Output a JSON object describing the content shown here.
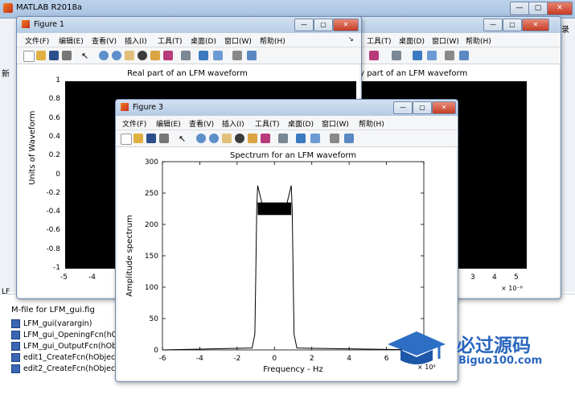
{
  "app": {
    "title": "MATLAB R2018a",
    "right_edge_text": "录",
    "left_edge_text": "新",
    "left_edge_text2": "LF",
    "m_file_label": "M-file for LFM_gui.fig",
    "functions": [
      "LFM_gui(varargin)",
      "LFM_gui_OpeningFcn(hO...",
      "LFM_gui_OutputFcn(hObj...",
      "edit1_CreateFcn(hObject,...",
      "edit2_CreateFcn(hObject,..."
    ]
  },
  "menus": [
    "文件(F)",
    "编辑(E)",
    "查看(V)",
    "插入(I)",
    "工具(T)",
    "桌面(D)",
    "窗口(W)",
    "帮助(H)"
  ],
  "figures": {
    "fig1": {
      "title": "Figure 1",
      "plot_title": "Real part of an LFM waveform",
      "ylabel": "Units of Waveform",
      "yticks": [
        "1",
        "0.8",
        "0.6",
        "0.4",
        "0.2",
        "0",
        "-0.2",
        "-0.4",
        "-0.6",
        "-0.8",
        "-1"
      ],
      "xticks": [
        "-5",
        "-4"
      ]
    },
    "fig2": {
      "plot_title_partial": "ry part of an LFM waveform",
      "xticks": [
        "3",
        "4",
        "5"
      ],
      "exponent": "× 10⁻⁶"
    },
    "fig3": {
      "title": "Figure 3",
      "plot_title": "Spectrum for an LFM waveform",
      "ylabel": "Amplitude spectrum",
      "xlabel": "Frequency - Hz",
      "exponent": "× 10⁸"
    }
  },
  "watermark": {
    "cn": "必过源码",
    "url": "Biguo100.com"
  },
  "chart_data": {
    "type": "line",
    "title": "Spectrum for an LFM waveform",
    "xlabel": "Frequency - Hz",
    "ylabel": "Amplitude spectrum",
    "x_exponent": "× 10⁸",
    "xlim": [
      -6,
      8
    ],
    "ylim": [
      0,
      300
    ],
    "xticks": [
      -6,
      -4,
      -2,
      0,
      2,
      4,
      6,
      8
    ],
    "yticks": [
      0,
      50,
      100,
      150,
      200,
      250,
      300
    ],
    "series": [
      {
        "x": [
          -6,
          -1.2,
          -1.05,
          -1.0,
          -0.95,
          -0.9,
          -0.6,
          0,
          0.6,
          0.9,
          0.95,
          1.0,
          1.05,
          1.2,
          8
        ],
        "y": [
          0,
          3,
          25,
          120,
          225,
          262,
          225,
          222,
          225,
          262,
          225,
          120,
          25,
          3,
          0
        ]
      }
    ],
    "grid": false
  }
}
